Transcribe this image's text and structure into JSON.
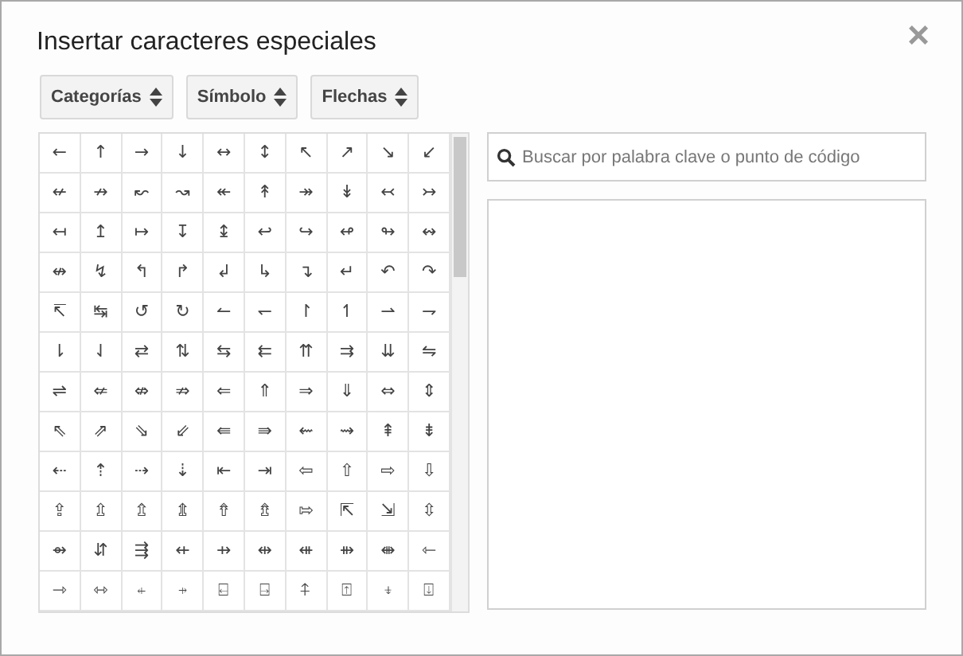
{
  "dialog": {
    "title": "Insertar caracteres especiales",
    "close": "×"
  },
  "dropdowns": [
    {
      "label": "Categorías"
    },
    {
      "label": "Símbolo"
    },
    {
      "label": "Flechas"
    }
  ],
  "grid": [
    [
      "←",
      "↑",
      "→",
      "↓",
      "↔",
      "↕",
      "↖",
      "↗",
      "↘",
      "↙"
    ],
    [
      "↚",
      "↛",
      "↜",
      "↝",
      "↞",
      "↟",
      "↠",
      "↡",
      "↢",
      "↣"
    ],
    [
      "↤",
      "↥",
      "↦",
      "↧",
      "↨",
      "↩",
      "↪",
      "↫",
      "↬",
      "↭"
    ],
    [
      "↮",
      "↯",
      "↰",
      "↱",
      "↲",
      "↳",
      "↴",
      "↵",
      "↶",
      "↷"
    ],
    [
      "↸",
      "↹",
      "↺",
      "↻",
      "↼",
      "↽",
      "↾",
      "↿",
      "⇀",
      "⇁"
    ],
    [
      "⇂",
      "⇃",
      "⇄",
      "⇅",
      "⇆",
      "⇇",
      "⇈",
      "⇉",
      "⇊",
      "⇋"
    ],
    [
      "⇌",
      "⇍",
      "⇎",
      "⇏",
      "⇐",
      "⇑",
      "⇒",
      "⇓",
      "⇔",
      "⇕"
    ],
    [
      "⇖",
      "⇗",
      "⇘",
      "⇙",
      "⇚",
      "⇛",
      "⇜",
      "⇝",
      "⇞",
      "⇟"
    ],
    [
      "⇠",
      "⇡",
      "⇢",
      "⇣",
      "⇤",
      "⇥",
      "⇦",
      "⇧",
      "⇨",
      "⇩"
    ],
    [
      "⇪",
      "⇫",
      "⇬",
      "⇭",
      "⇮",
      "⇯",
      "⇰",
      "⇱",
      "⇲",
      "⇳"
    ],
    [
      "⇴",
      "⇵",
      "⇶",
      "⇷",
      "⇸",
      "⇹",
      "⇺",
      "⇻",
      "⇼",
      "⇽"
    ],
    [
      "⇾",
      "⇿",
      "⍅",
      "⍆",
      "⍇",
      "⍈",
      "⍏",
      "⍐",
      "⍖",
      "⍗"
    ]
  ],
  "search": {
    "placeholder": "Buscar por palabra clave o punto de código"
  }
}
